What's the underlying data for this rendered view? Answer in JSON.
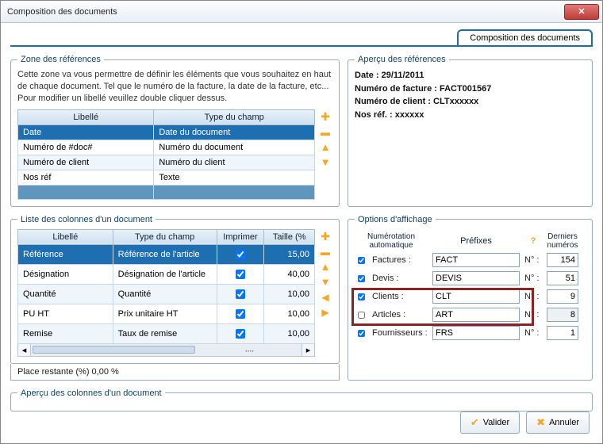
{
  "window": {
    "title": "Composition des documents",
    "tab_label": "Composition des documents"
  },
  "zone_ref": {
    "legend": "Zone des références",
    "help": "Cette zone va vous permettre de définir les éléments que vous souhaitez en haut de chaque document. Tel que le numéro de la facture, la date de la facture, etc... Pour modifier un libellé veuillez double cliquer dessus.",
    "headers": {
      "libelle": "Libellé",
      "type": "Type du champ"
    },
    "rows": [
      {
        "libelle": "Date",
        "type": "Date du document",
        "sel": true
      },
      {
        "libelle": "Numéro de #doc#",
        "type": "Numéro du document"
      },
      {
        "libelle": "Numéro de client",
        "type": "Numéro du client",
        "alt": true
      },
      {
        "libelle": "Nos réf",
        "type": "Texte"
      }
    ]
  },
  "apercu_ref": {
    "legend": "Aperçu des références",
    "lines": [
      "Date : 29/11/2011",
      "Numéro de facture : FACT001567",
      "Numéro de client : CLTxxxxxx",
      "Nos réf. : xxxxxx"
    ]
  },
  "liste_cols": {
    "legend": "Liste des colonnes d'un document",
    "headers": {
      "libelle": "Libellé",
      "type": "Type du champ",
      "imprimer": "Imprimer",
      "taille": "Taille (%"
    },
    "rows": [
      {
        "libelle": "Référence",
        "type": "Référence de l'article",
        "imprimer": true,
        "taille": "15,00",
        "sel": true
      },
      {
        "libelle": "Désignation",
        "type": "Désignation de l'article",
        "imprimer": true,
        "taille": "40,00"
      },
      {
        "libelle": "Quantité",
        "type": "Quantité",
        "imprimer": true,
        "taille": "10,00",
        "alt": true
      },
      {
        "libelle": "PU HT",
        "type": "Prix unitaire HT",
        "imprimer": true,
        "taille": "10,00"
      },
      {
        "libelle": "Remise",
        "type": "Taux de remise",
        "imprimer": true,
        "taille": "10,00",
        "alt": true
      }
    ],
    "place_restante": "Place restante (%) 0,00 %"
  },
  "options": {
    "legend": "Options d'affichage",
    "headers": {
      "nauto": "Numérotation automatique",
      "prefixes": "Préfixes",
      "derniers": "Derniers numéros",
      "n": "N° :"
    },
    "rows": [
      {
        "label": "Factures :",
        "checked": true,
        "prefix": "FACT",
        "num": "154"
      },
      {
        "label": "Devis :",
        "checked": true,
        "prefix": "DEVIS",
        "num": "51"
      },
      {
        "label": "Clients :",
        "checked": true,
        "prefix": "CLT",
        "num": "9"
      },
      {
        "label": "Articles :",
        "checked": false,
        "prefix": "ART",
        "num": "8",
        "ro": true
      },
      {
        "label": "Fournisseurs :",
        "checked": true,
        "prefix": "FRS",
        "num": "1"
      }
    ]
  },
  "apercu_cols": {
    "legend": "Aperçu des colonnes d'un document"
  },
  "footer": {
    "valider": "Valider",
    "annuler": "Annuler"
  }
}
